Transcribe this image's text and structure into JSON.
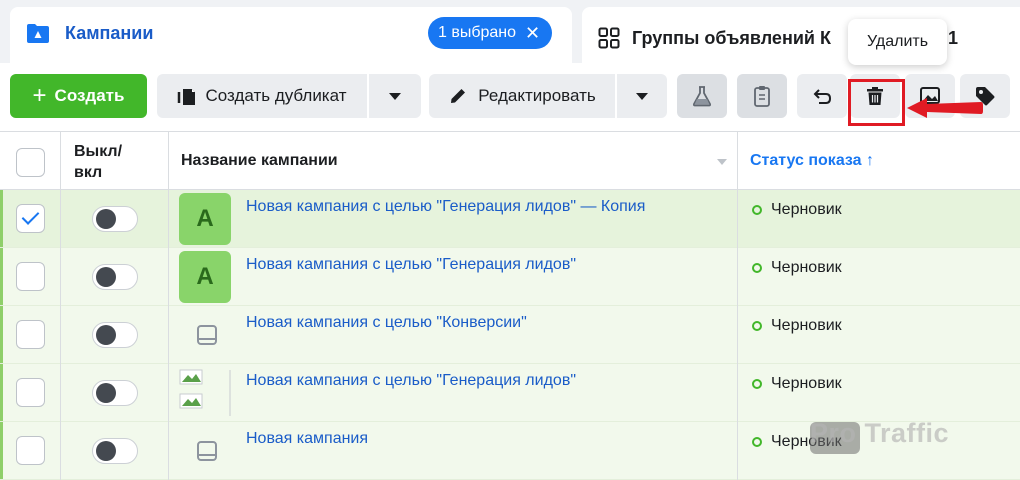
{
  "tabs": {
    "campaigns": {
      "title": "Кампании",
      "selected_pill": "1 выбрано",
      "close_glyph": "✕"
    },
    "groups": {
      "title": "Группы объявлений К",
      "tail": "1"
    }
  },
  "tooltip": {
    "text": "Удалить"
  },
  "toolbar": {
    "create_label": "Создать",
    "duplicate_label": "Создать дубликат",
    "edit_label": "Редактировать"
  },
  "table": {
    "headers": {
      "onoff_line1": "Выкл/",
      "onoff_line2": "вкл",
      "name": "Название кампании",
      "status": "Статус показа ↑"
    },
    "rows": [
      {
        "name": "Новая кампания с целью \"Генерация лидов\" — Копия",
        "status": "Черновик",
        "thumb": "A",
        "selected": true
      },
      {
        "name": "Новая кампания с целью \"Генерация лидов\"",
        "status": "Черновик",
        "thumb": "A",
        "selected": false
      },
      {
        "name": "Новая кампания с целью \"Конверсии\"",
        "status": "Черновик",
        "thumb": "",
        "selected": false
      },
      {
        "name": "Новая кампания с целью \"Генерация лидов\"",
        "status": "Черновик",
        "thumb": "",
        "selected": false
      },
      {
        "name": "Новая кампания",
        "status": "Черновик",
        "thumb": "",
        "selected": false
      }
    ]
  },
  "watermark": {
    "text": "Pro Traffic"
  },
  "colors": {
    "accent": "#1877f2",
    "create": "#42b72a",
    "highlight": "#e01b24",
    "status": "#42b72a"
  }
}
